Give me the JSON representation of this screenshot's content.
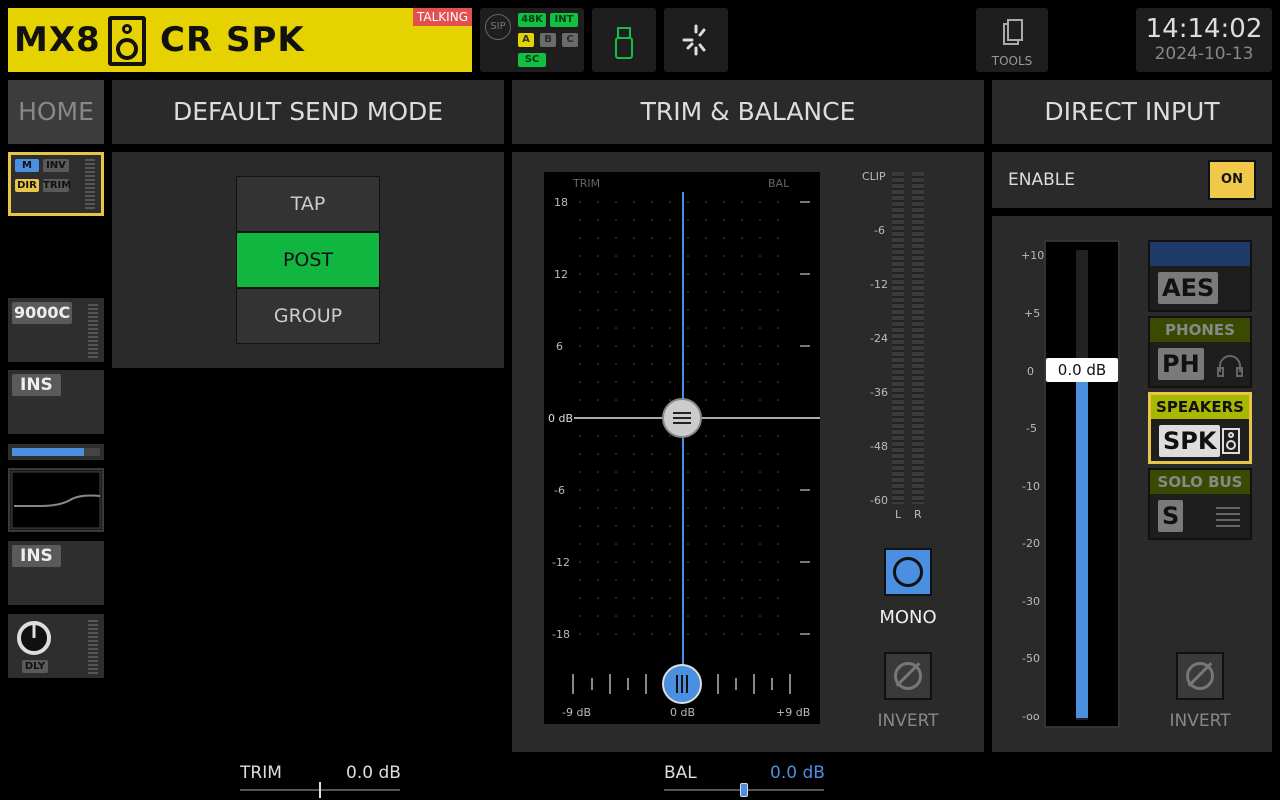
{
  "header": {
    "device": "MX8",
    "channel_name": "CR SPK",
    "talking_badge": "TALKING",
    "colors": {
      "title_bg": "#e6d200",
      "talking_bg": "#e35050",
      "active_green": "#11b640",
      "accent_blue": "#4a8fe0",
      "selected_yellow": "#f0c84a"
    }
  },
  "status": {
    "sip": "SIP",
    "rate": "48K",
    "clock_src": "INT",
    "a": "A",
    "b": "B",
    "c": "C",
    "sc": "SC"
  },
  "tools_label": "TOOLS",
  "clock": {
    "time": "14:14:02",
    "date": "2024-10-13"
  },
  "home_label": "HOME",
  "sections": {
    "send": "DEFAULT SEND MODE",
    "trim": "TRIM & BALANCE",
    "direct": "DIRECT INPUT"
  },
  "strip": {
    "m": "M",
    "inv": "INV",
    "dir": "DIR",
    "trim": "TRIM",
    "model": "9000C",
    "ins1": "INS",
    "ins2": "INS",
    "dly": "DLY"
  },
  "send_modes": {
    "tap": "TAP",
    "post": "POST",
    "group": "GROUP",
    "selected": "POST"
  },
  "trim_balance": {
    "trim_axis": "TRIM",
    "bal_axis": "BAL",
    "ticks": {
      "t18": "18",
      "t12": "12",
      "t6": "6",
      "t0": "0 dB",
      "tm6": "-6",
      "tm12": "-12",
      "tm18": "-18"
    },
    "bal_left": "-9 dB",
    "bal_center": "0 dB",
    "bal_right": "+9 dB",
    "trim_value_db": 0,
    "balance_value_db": 0
  },
  "meter": {
    "clip": "CLIP",
    "m6": "-6",
    "m12": "-12",
    "m24": "-24",
    "m36": "-36",
    "m48": "-48",
    "m60": "-60",
    "l": "L",
    "r": "R"
  },
  "mono_label": "MONO",
  "invert_label": "INVERT",
  "direct_input": {
    "enable_label": "ENABLE",
    "enable_value": "ON",
    "scale": {
      "p10": "+10",
      "p5": "+5",
      "z": "0",
      "m5": "-5",
      "m10": "-10",
      "m20": "-20",
      "m30": "-30",
      "m50": "-50",
      "inf": "-oo"
    },
    "level_readout": "0.0 dB",
    "level_fraction": 0.73,
    "sources": {
      "aes": "AES",
      "phones_title": "PHONES",
      "phones": "PH",
      "speakers_title": "SPEAKERS",
      "speakers": "SPK",
      "solo_title": "SOLO BUS",
      "solo": "S"
    },
    "selected_source": "SPEAKERS",
    "invert_label": "INVERT"
  },
  "bottom": {
    "trim_label": "TRIM",
    "trim_value": "0.0 dB",
    "bal_label": "BAL",
    "bal_value": "0.0 dB"
  }
}
